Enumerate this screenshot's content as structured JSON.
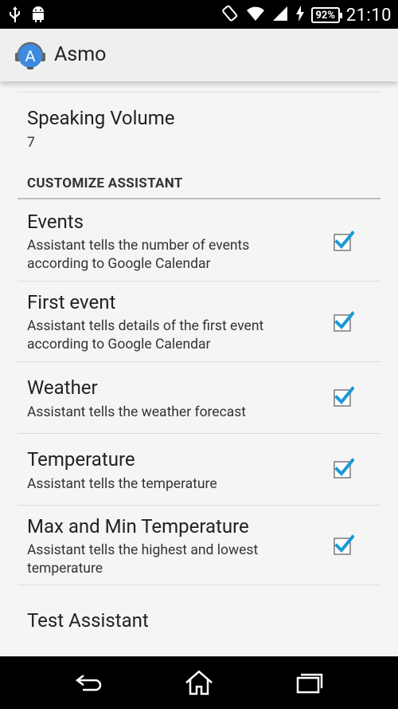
{
  "status_bar": {
    "time": "21:10",
    "battery": "92%",
    "icons": [
      "usb-icon",
      "android-debug-icon",
      "rotation-icon",
      "wifi-icon",
      "signal-icon",
      "charging-icon"
    ]
  },
  "action_bar": {
    "app_icon_letter": "A",
    "title": "Asmo"
  },
  "preferences": {
    "speaking_volume": {
      "title": "Speaking Volume",
      "value": "7"
    },
    "category_customize": "CUSTOMIZE ASSISTANT",
    "items": [
      {
        "title": "Events",
        "summary_line1": "Assistant tells the number of events",
        "summary_line2": "according to Google Calendar",
        "checked": true
      },
      {
        "title": "First event",
        "summary_line1": "Assistant tells details of the first event",
        "summary_line2": "according to Google Calendar",
        "checked": true
      },
      {
        "title": "Weather",
        "summary_line1": "Assistant tells the weather forecast",
        "summary_line2": "",
        "checked": true
      },
      {
        "title": "Temperature",
        "summary_line1": "Assistant tells the temperature",
        "summary_line2": "",
        "checked": true
      },
      {
        "title": "Max and Min Temperature",
        "summary_line1": "Assistant tells the highest and lowest",
        "summary_line2": "temperature",
        "checked": true
      }
    ],
    "test_assistant": {
      "title": "Test Assistant"
    }
  },
  "colors": {
    "checkbox_accent": "#1a9ad6",
    "app_icon_blue": "#3d8be0"
  },
  "nav_bar": {
    "icons": [
      "back-icon",
      "home-icon",
      "recents-icon"
    ]
  }
}
